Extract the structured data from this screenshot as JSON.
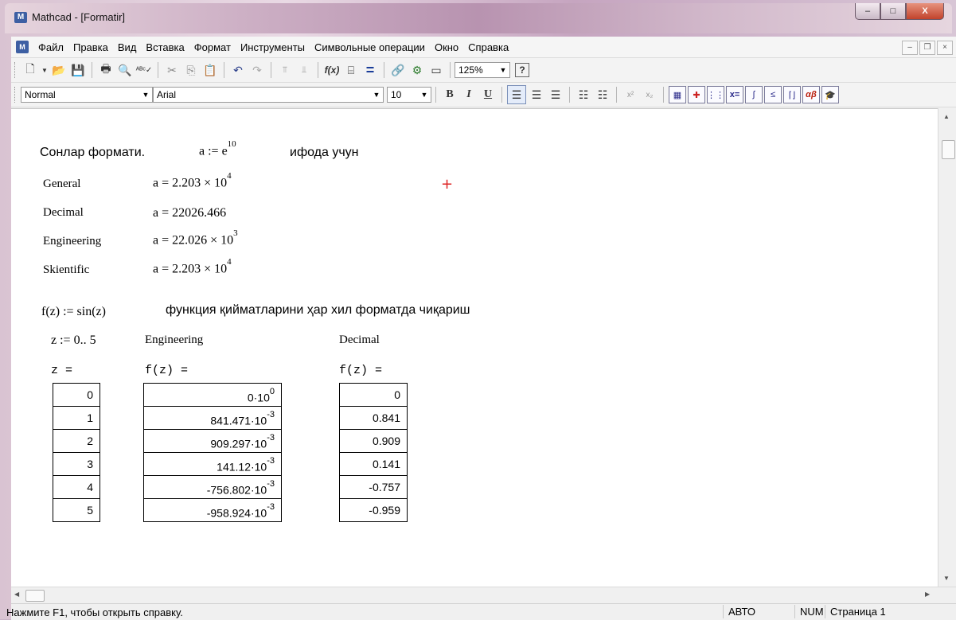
{
  "window": {
    "title": "Mathcad - [Formatir]",
    "min": "–",
    "max": "□",
    "close": "X"
  },
  "menu": {
    "items": [
      "Файл",
      "Правка",
      "Вид",
      "Вставка",
      "Формат",
      "Инструменты",
      "Символьные операции",
      "Окно",
      "Справка"
    ]
  },
  "toolbar": {
    "zoom": "125%"
  },
  "format_toolbar": {
    "style": "Normal",
    "font": "Arial",
    "size": "10",
    "bold": "B",
    "italic": "I",
    "underline": "U"
  },
  "worksheet": {
    "header_text": "Сонлар формати.",
    "header_expr": "a := e",
    "header_exp": "10",
    "header_suffix": "ифода учун",
    "formats": [
      {
        "label": "General",
        "expr": "a = 2.203 × 10",
        "exp": "4"
      },
      {
        "label": "Decimal",
        "expr": "a = 22026.466",
        "exp": ""
      },
      {
        "label": "Engineering",
        "expr": "a = 22.026 × 10",
        "exp": "3"
      },
      {
        "label": "Skientific",
        "expr": "a = 2.203 × 10",
        "exp": "4"
      }
    ],
    "func_def": "f(z) := sin(z)",
    "func_text": "функция қийматларини ҳар хил форматда чиқариш",
    "range_def": "z := 0.. 5",
    "col_eng_label": "Engineering",
    "col_dec_label": "Decimal",
    "z_eq": "z =",
    "f_eq_eng": "f(z) =",
    "f_eq_dec": "f(z) =",
    "z_values": [
      "0",
      "1",
      "2",
      "3",
      "4",
      "5"
    ],
    "eng_values": [
      {
        "m": "0·10",
        "e": "0"
      },
      {
        "m": "841.471·10",
        "e": "-3"
      },
      {
        "m": "909.297·10",
        "e": "-3"
      },
      {
        "m": "141.12·10",
        "e": "-3"
      },
      {
        "m": "-756.802·10",
        "e": "-3"
      },
      {
        "m": "-958.924·10",
        "e": "-3"
      }
    ],
    "dec_values": [
      "0",
      "0.841",
      "0.909",
      "0.141",
      "-0.757",
      "-0.959"
    ],
    "cursor": "+"
  },
  "status": {
    "help": "Нажмите F1, чтобы открыть справку.",
    "mode": "АВТО",
    "num": "NUM",
    "page": "Страница 1"
  }
}
